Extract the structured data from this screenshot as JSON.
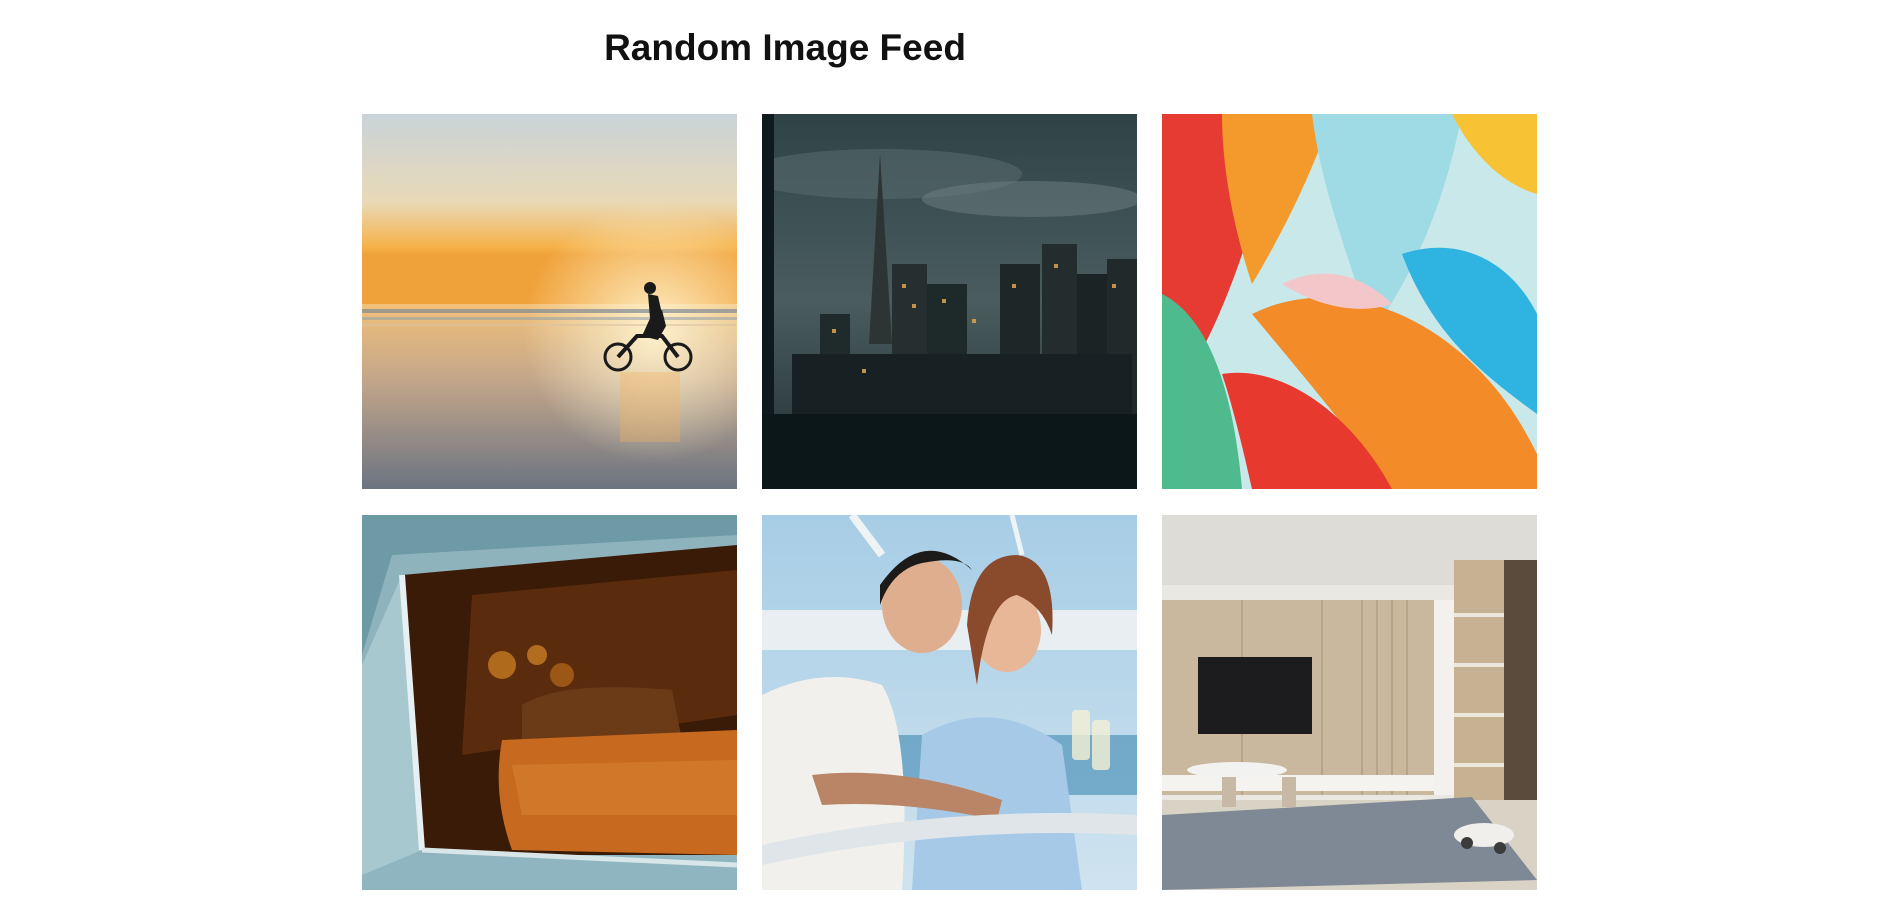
{
  "page": {
    "title": "Random Image Feed"
  },
  "feed": {
    "images": [
      {
        "subject": "motorcyclist-beach-sunset"
      },
      {
        "subject": "city-skyline-night"
      },
      {
        "subject": "abstract-colorful-waves"
      },
      {
        "subject": "vintage-car-interior"
      },
      {
        "subject": "couple-on-boat"
      },
      {
        "subject": "modern-living-room"
      }
    ]
  },
  "colors": {
    "background": "#ffffff",
    "title": "#111111"
  }
}
